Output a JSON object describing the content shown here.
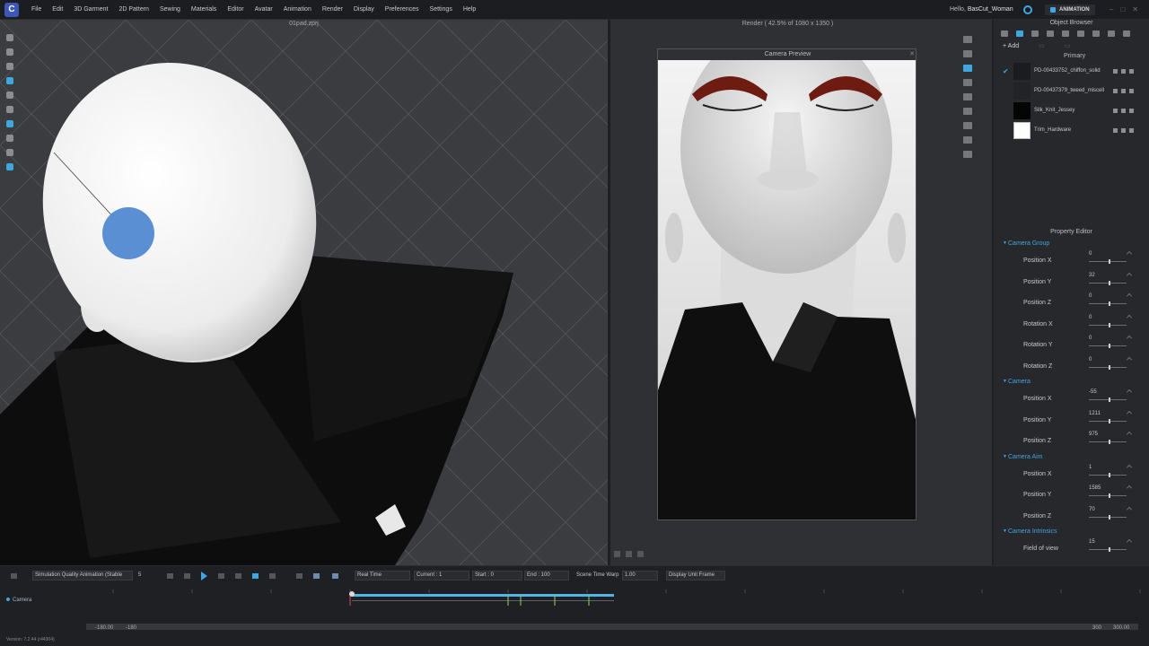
{
  "app": {
    "logo_letter": "C"
  },
  "menu": [
    "File",
    "Edit",
    "3D Garment",
    "2D Pattern",
    "Sewing",
    "Materials",
    "Editor",
    "Avatar",
    "Animation",
    "Render",
    "Display",
    "Preferences",
    "Settings",
    "Help"
  ],
  "header": {
    "greeting": "Hello,",
    "username": "BasCut_Woman",
    "mode": "ANIMATION"
  },
  "viewport": {
    "title": "01pad.zprj"
  },
  "render": {
    "title": "Render ( 42.5% of 1080 x 1350 )",
    "camera_preview_title": "Camera Preview"
  },
  "object_browser": {
    "title": "Object Browser",
    "add_label": "+ Add",
    "group_label": "Primary",
    "fabrics": [
      {
        "name": "PD-00433752_chiffon_solid",
        "swatch": "#1c1c1e",
        "checked": true
      },
      {
        "name": "PD-00437379_tweed_miscell",
        "swatch": "#232325",
        "checked": false
      },
      {
        "name": "Silk_Knit_Jessey",
        "swatch": "#050505",
        "checked": false
      },
      {
        "name": "Trim_Hardware",
        "swatch": "#ffffff",
        "checked": false
      }
    ]
  },
  "property_editor": {
    "title": "Property Editor",
    "groups": [
      {
        "name": "Camera Group",
        "rows": [
          {
            "label": "Position X",
            "value": "0"
          },
          {
            "label": "Position Y",
            "value": "32"
          },
          {
            "label": "Position Z",
            "value": "0"
          },
          {
            "label": "Rotation X",
            "value": "0"
          },
          {
            "label": "Rotation Y",
            "value": "0"
          },
          {
            "label": "Rotation Z",
            "value": "0"
          }
        ]
      },
      {
        "name": "Camera",
        "rows": [
          {
            "label": "Position X",
            "value": "-55"
          },
          {
            "label": "Position Y",
            "value": "1211"
          },
          {
            "label": "Position Z",
            "value": "975"
          }
        ]
      },
      {
        "name": "Camera Aim",
        "rows": [
          {
            "label": "Position X",
            "value": "1"
          },
          {
            "label": "Position Y",
            "value": "1585"
          },
          {
            "label": "Position Z",
            "value": "70"
          }
        ]
      },
      {
        "name": "Camera Intrinsics",
        "rows": [
          {
            "label": "Field of view",
            "value": "15"
          }
        ]
      }
    ]
  },
  "timeline": {
    "quality": "Simulation Quality Animation (Stable",
    "quality_value": "5",
    "realtime": "Real Time",
    "current": "Current : 1",
    "start": "Start : 0",
    "end": "End : 100",
    "warp_label": "Scene Time Warp",
    "warp_value": "1.00",
    "display_unit": "Display Unit Frame",
    "track": "Camera",
    "range_start": "-180.00",
    "range_start_2": "-180",
    "range_end": "300",
    "range_end_2": "300.00",
    "version": "Version: 7.2.44 (r44304)"
  },
  "colors": {
    "accent": "#3fa7e0",
    "marker": "#5b8fd4",
    "eyebrow": "#6e1c12"
  }
}
